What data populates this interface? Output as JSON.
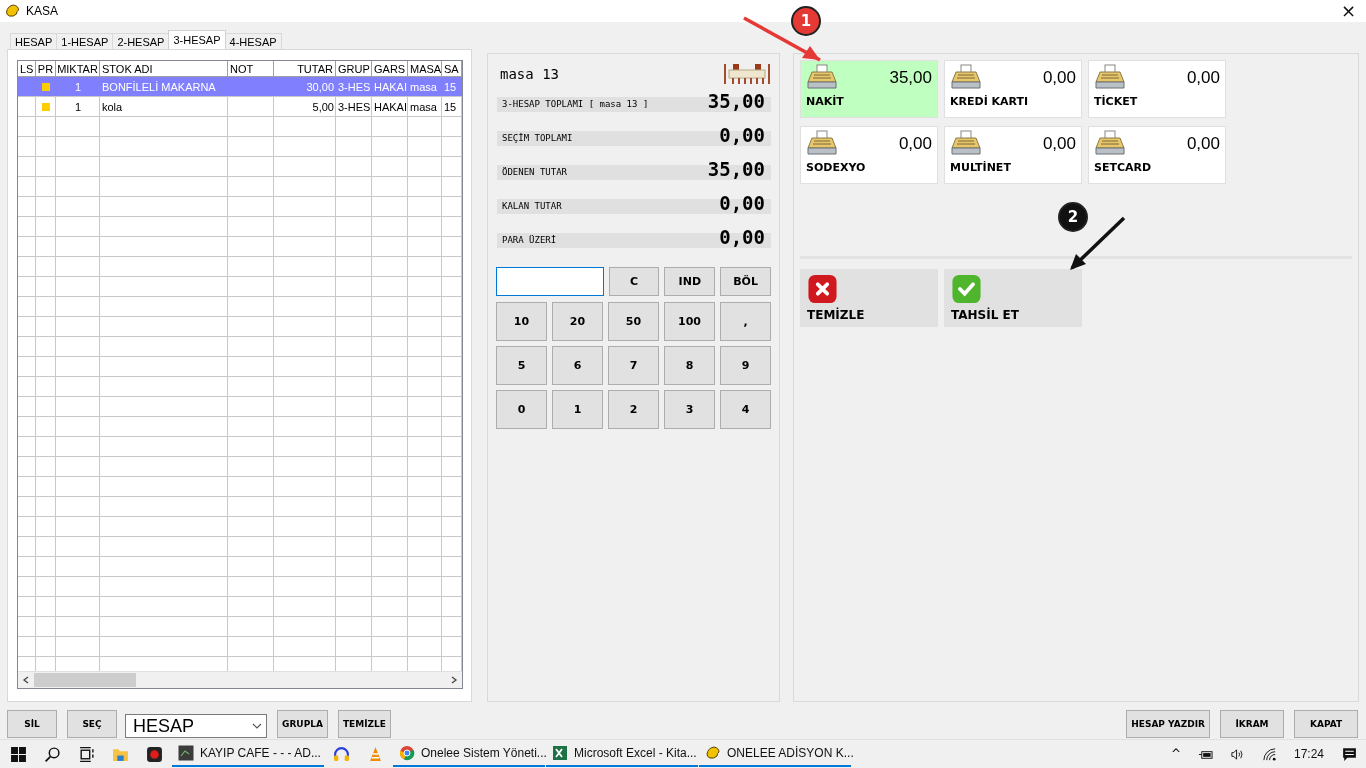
{
  "window": {
    "title": "KASA",
    "close": "×"
  },
  "tabs": [
    {
      "label": "HESAP",
      "selected": false
    },
    {
      "label": "1-HESAP",
      "selected": false
    },
    {
      "label": "2-HESAP",
      "selected": false
    },
    {
      "label": "3-HESAP",
      "selected": true
    },
    {
      "label": "4-HESAP",
      "selected": false
    }
  ],
  "table": {
    "columns": [
      "LS",
      "PR",
      "MIKTAR",
      "STOK ADI",
      "NOT",
      "TUTAR",
      "GRUP",
      "GARS",
      "MASA",
      "SA"
    ],
    "rows": [
      {
        "selected": true,
        "pr_flag": true,
        "cells": [
          "",
          "",
          "1",
          "BONFİLELİ MAKARNA",
          "",
          "30,00",
          "3-HES",
          "HAKAI",
          "masa",
          "15"
        ]
      },
      {
        "selected": false,
        "pr_flag": true,
        "cells": [
          "",
          "",
          "1",
          "kola",
          "",
          "5,00",
          "3-HES",
          "HAKAI",
          "masa",
          "15"
        ]
      }
    ]
  },
  "summary": {
    "table_name": "masa 13",
    "lines": [
      {
        "label": "3-HESAP TOPLAMI [ masa 13 ]",
        "value": "35,00"
      },
      {
        "label": "SEÇİM TOPLAMI",
        "value": "0,00"
      },
      {
        "label": "ÖDENEN TUTAR",
        "value": "35,00"
      },
      {
        "label": "KALAN TUTAR",
        "value": "0,00"
      },
      {
        "label": "PARA ÜZERİ",
        "value": "0,00"
      }
    ]
  },
  "keypad": {
    "top_keys": [
      "C",
      "IND",
      "BÖL"
    ],
    "keys": [
      "10",
      "20",
      "50",
      "100",
      ",",
      "5",
      "6",
      "7",
      "8",
      "9",
      "0",
      "1",
      "2",
      "3",
      "4"
    ]
  },
  "payments": [
    {
      "name": "NAKİT",
      "amount": "35,00",
      "selected": true
    },
    {
      "name": "KREDİ KARTI",
      "amount": "0,00",
      "selected": false
    },
    {
      "name": "TİCKET",
      "amount": "0,00",
      "selected": false
    },
    {
      "name": "SODEXYO",
      "amount": "0,00",
      "selected": false
    },
    {
      "name": "MULTİNET",
      "amount": "0,00",
      "selected": false
    },
    {
      "name": "SETCARD",
      "amount": "0,00",
      "selected": false
    }
  ],
  "actions": [
    {
      "kind": "clear",
      "label": "TEMİZLE"
    },
    {
      "kind": "collect",
      "label": "TAHSİL ET"
    }
  ],
  "annotations": [
    {
      "label": "1",
      "color": "#e53935"
    },
    {
      "label": "2",
      "color": "#111111"
    }
  ],
  "bottom_left": {
    "buttons_before": [
      "SİL",
      "SEÇ"
    ],
    "dropdown": "HESAP",
    "buttons_after": [
      "GRUPLA",
      "TEMİZLE"
    ]
  },
  "bottom_right": [
    "HESAP YAZDIR",
    "İKRAM",
    "KAPAT"
  ],
  "taskbar": {
    "apps": [
      {
        "kind": "terminal",
        "label": "KAYIP CAFE -  -  - AD..."
      },
      {
        "kind": "headphones"
      },
      {
        "kind": "cone"
      },
      {
        "kind": "browser",
        "label": "Onelee Sistem Yöneti..."
      },
      {
        "kind": "excel",
        "label": "Microsoft Excel - Kita..."
      },
      {
        "kind": "app",
        "label": "ONELEE ADİSYON  K..."
      }
    ],
    "tray_caret": "^",
    "time": "17:24"
  }
}
